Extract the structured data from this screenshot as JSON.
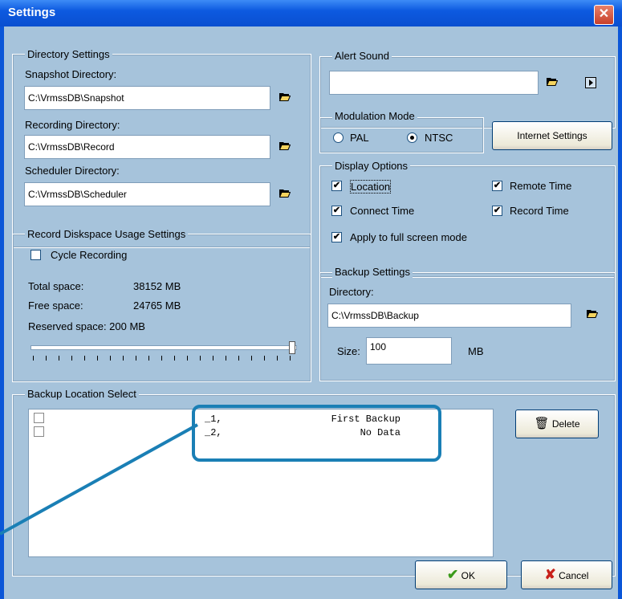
{
  "window": {
    "title": "Settings"
  },
  "directory_settings": {
    "legend": "Directory Settings",
    "snapshot_label": "Snapshot Directory:",
    "snapshot_value": "C:\\VrmssDB\\Snapshot",
    "recording_label": "Recording Directory:",
    "recording_value": "C:\\VrmssDB\\Record",
    "scheduler_label": "Scheduler Directory:",
    "scheduler_value": "C:\\VrmssDB\\Scheduler"
  },
  "alert_sound": {
    "legend": "Alert Sound",
    "value": ""
  },
  "modulation": {
    "legend": "Modulation Mode",
    "options": [
      {
        "label": "PAL",
        "selected": false
      },
      {
        "label": "NTSC",
        "selected": true
      }
    ]
  },
  "internet_settings_button": "Internet Settings",
  "display_options": {
    "legend": "Display Options",
    "location": "Location",
    "remote_time": "Remote Time",
    "connect_time": "Connect Time",
    "record_time": "Record Time",
    "apply_full_screen": "Apply to full screen mode"
  },
  "diskspace": {
    "legend": "Record Diskspace Usage Settings",
    "cycle_recording": "Cycle Recording",
    "total_label": "Total space:",
    "total_value": "38152 MB",
    "free_label": "Free space:",
    "free_value": "24765 MB",
    "reserved_text": "Reserved space: 200 MB",
    "slider_fraction": 1.0
  },
  "backup_settings": {
    "legend": "Backup Settings",
    "directory_label": "Directory:",
    "directory_value": "C:\\VrmssDB\\Backup",
    "size_label": "Size:",
    "size_value": "100",
    "size_unit": "MB"
  },
  "backup_location": {
    "legend": "Backup Location Select",
    "items": [
      {
        "index": "_1,",
        "name": "First Backup"
      },
      {
        "index": "_2,",
        "name": "No Data"
      }
    ],
    "delete_button": "Delete"
  },
  "buttons": {
    "ok": "OK",
    "cancel": "Cancel"
  },
  "colors": {
    "accent_callout": "#1a7fb5",
    "dialog_bg": "#a6c3db",
    "titlebar": "#0a56d8"
  }
}
